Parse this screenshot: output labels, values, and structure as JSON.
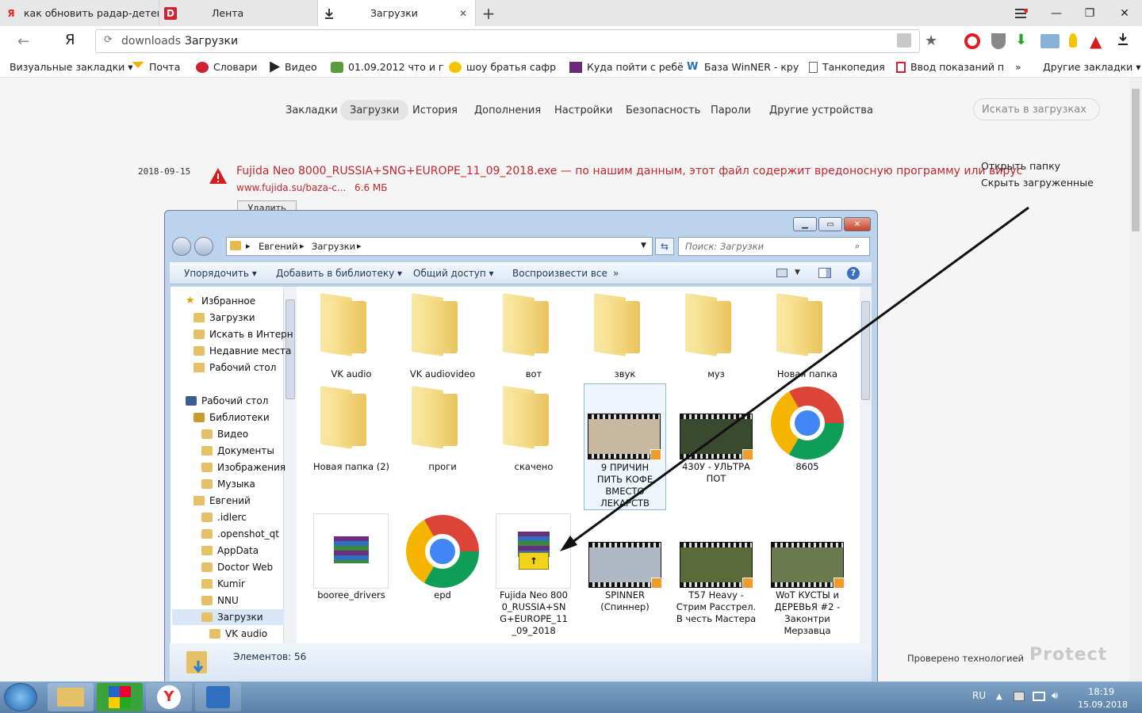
{
  "browser": {
    "tabs": [
      {
        "label": "как обновить радар-детект",
        "icon": "yandex-y-icon"
      },
      {
        "label": "Лента",
        "icon": "d-logo-icon"
      },
      {
        "label": "Загрузки",
        "icon": "download-icon"
      }
    ],
    "new_tab": "+",
    "window_controls": {
      "minimize": "—",
      "restore": "❐",
      "close": "✕"
    },
    "address": {
      "url_prefix": "downloads",
      "url_title": "Загрузки"
    },
    "yandex_logo": "Я"
  },
  "bookmarks": [
    {
      "label": "Визуальные закладки ▾"
    },
    {
      "label": "Почта"
    },
    {
      "label": "Словари"
    },
    {
      "label": "Видео"
    },
    {
      "label": "01.09.2012 что и г"
    },
    {
      "label": "шоу братья сафр"
    },
    {
      "label": "Куда пойти с ребё"
    },
    {
      "label": "База WinNER - кру"
    },
    {
      "label": "Танкопедия"
    },
    {
      "label": "Ввод показаний п"
    },
    {
      "label": "»"
    },
    {
      "label": "Другие закладки ▾"
    }
  ],
  "settings_nav": [
    "Закладки",
    "Загрузки",
    "История",
    "Дополнения",
    "Настройки",
    "Безопасность",
    "Пароли",
    "Другие устройства"
  ],
  "downloads_search_placeholder": "Искать в загрузках",
  "download_entry": {
    "date": "2018-09-15",
    "title": "Fujida Neo 8000_RUSSIA+SNG+EUROPE_11_09_2018.exe — по нашим данным, этот файл содержит вредоносную программу или вирус",
    "source": "www.fujida.su/baza-c...",
    "size": "6.6 МБ",
    "button": "Удалить"
  },
  "side_actions": {
    "open_folder": "Открыть папку",
    "hide_downloaded": "Скрыть загруженные"
  },
  "protect": {
    "verified": "Проверено технологией",
    "brand": "Protect"
  },
  "explorer": {
    "breadcrumb": [
      "Евгений",
      "Загрузки"
    ],
    "search_placeholder": "Поиск: Загрузки",
    "toolbar": [
      "Упорядочить ▾",
      "Добавить в библиотеку ▾",
      "Общий доступ ▾",
      "Воспроизвести все",
      "»"
    ],
    "nav": [
      {
        "label": "Избранное",
        "indent": 0
      },
      {
        "label": "Загрузки",
        "indent": 1
      },
      {
        "label": "Искать в Интерн",
        "indent": 1
      },
      {
        "label": "Недавние места",
        "indent": 1
      },
      {
        "label": "Рабочий стол",
        "indent": 1
      },
      {
        "label": "Рабочий стол",
        "indent": 0
      },
      {
        "label": "Библиотеки",
        "indent": 1
      },
      {
        "label": "Видео",
        "indent": 2
      },
      {
        "label": "Документы",
        "indent": 2
      },
      {
        "label": "Изображения",
        "indent": 2
      },
      {
        "label": "Музыка",
        "indent": 2
      },
      {
        "label": "Евгений",
        "indent": 1
      },
      {
        "label": ".idlerc",
        "indent": 2
      },
      {
        "label": ".openshot_qt",
        "indent": 2
      },
      {
        "label": "AppData",
        "indent": 2
      },
      {
        "label": "Doctor Web",
        "indent": 2
      },
      {
        "label": "Kumir",
        "indent": 2
      },
      {
        "label": "NNU",
        "indent": 2
      },
      {
        "label": "Загрузки",
        "indent": 2
      },
      {
        "label": "VK audio",
        "indent": 3
      }
    ],
    "items": [
      {
        "label": "VK audio",
        "kind": "folder"
      },
      {
        "label": "VK audiovideo",
        "kind": "folder"
      },
      {
        "label": "вот",
        "kind": "folder"
      },
      {
        "label": "звук",
        "kind": "folder"
      },
      {
        "label": "муз",
        "kind": "folder"
      },
      {
        "label": "Новая папка",
        "kind": "folder"
      },
      {
        "label": "Новая папка (2)",
        "kind": "folder"
      },
      {
        "label": "проги",
        "kind": "folder"
      },
      {
        "label": "скачено",
        "kind": "folder"
      },
      {
        "label": "9 ПРИЧИН ПИТЬ КОФЕ ВМЕСТО ЛЕКАРСТВ",
        "kind": "video"
      },
      {
        "label": "430У - УЛЬТРА ПОТ",
        "kind": "video"
      },
      {
        "label": "8605",
        "kind": "chrome"
      },
      {
        "label": "booree_drivers",
        "kind": "archive"
      },
      {
        "label": "epd",
        "kind": "chrome"
      },
      {
        "label": "Fujida Neo 8000_RUSSIA+SNG+EUROPE_11_09_2018",
        "kind": "installer"
      },
      {
        "label": "SPINNER (Спиннер)",
        "kind": "video"
      },
      {
        "label": "T57 Heavy - Стрим Расстрел. В честь Мастера",
        "kind": "video"
      },
      {
        "label": "WoT КУСТЫ и ДЕРЕВЬЯ #2 - Законтри Мерзавца",
        "kind": "video"
      }
    ],
    "status": "Элементов: 56"
  },
  "taskbar": {
    "lang": "RU",
    "time": "18:19",
    "date": "15.09.2018"
  }
}
